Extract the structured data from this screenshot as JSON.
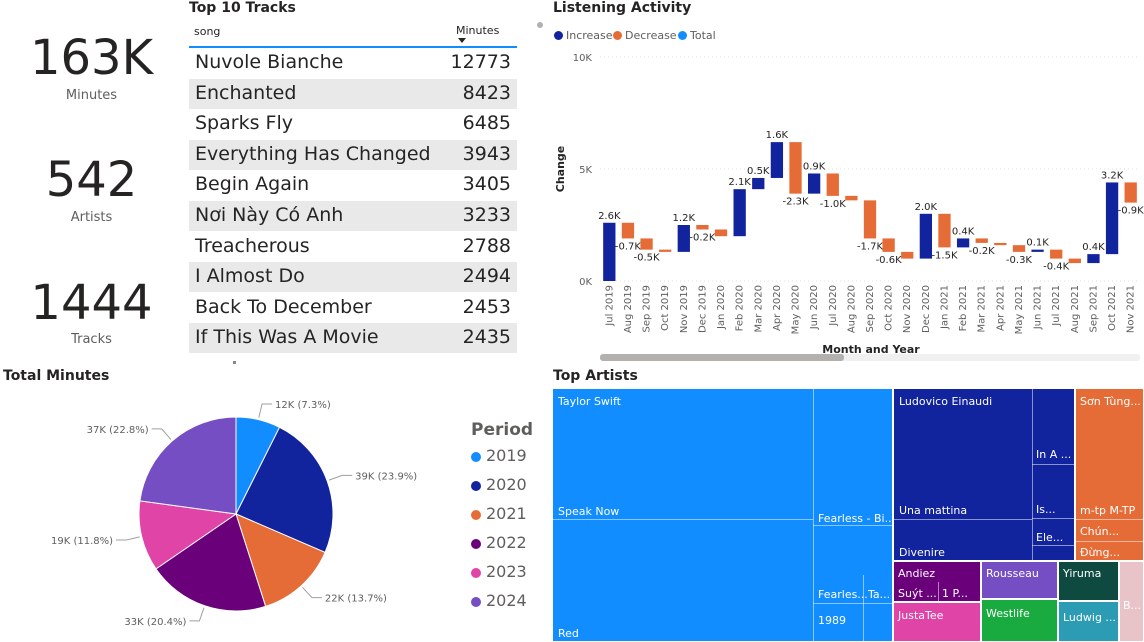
{
  "kpis": [
    {
      "value": "163K",
      "label": "Minutes"
    },
    {
      "value": "542",
      "label": "Artists"
    },
    {
      "value": "1444",
      "label": "Tracks"
    }
  ],
  "top_tracks": {
    "title": "Top 10 Tracks",
    "col_song": "song",
    "col_minutes": "Minutes",
    "rows": [
      {
        "song": "Nuvole Bianche",
        "minutes": "12773"
      },
      {
        "song": "Enchanted",
        "minutes": "8423"
      },
      {
        "song": "Sparks Fly",
        "minutes": "6485"
      },
      {
        "song": "Everything Has Changed",
        "minutes": "3943"
      },
      {
        "song": "Begin Again",
        "minutes": "3405"
      },
      {
        "song": "Nơi Này Có Anh",
        "minutes": "3233"
      },
      {
        "song": "Treacherous",
        "minutes": "2788"
      },
      {
        "song": "I Almost Do",
        "minutes": "2494"
      },
      {
        "song": "Back To December",
        "minutes": "2453"
      },
      {
        "song": "If This Was A Movie",
        "minutes": "2435"
      }
    ]
  },
  "colors": {
    "increase": "#12239e",
    "decrease": "#e66c37",
    "total": "#118dff",
    "p2019": "#118dff",
    "p2020": "#12239e",
    "p2021": "#e66c37",
    "p2022": "#6b007b",
    "p2023": "#e044a7",
    "p2024": "#744ec2"
  },
  "chart_data": [
    {
      "type": "waterfall",
      "title": "Listening Activity",
      "xlabel": "Month and Year",
      "ylabel": "Change",
      "legend": [
        "Increase",
        "Decrease",
        "Total"
      ],
      "legend_position": "top-left",
      "yticks": [
        "0K",
        "5K",
        "10K"
      ],
      "ylim": [
        0,
        10000
      ],
      "categories": [
        "Jul 2019",
        "Aug 2019",
        "Sep 2019",
        "Oct 2019",
        "Nov 2019",
        "Dec 2019",
        "Jan 2020",
        "Feb 2020",
        "Mar 2020",
        "Apr 2020",
        "May 2020",
        "Jun 2020",
        "Jul 2020",
        "Aug 2020",
        "Sep 2020",
        "Oct 2020",
        "Nov 2020",
        "Dec 2020",
        "Jan 2021",
        "Feb 2021",
        "Mar 2021",
        "Apr 2021",
        "May 2021",
        "Jun 2021",
        "Jul 2021",
        "Aug 2021",
        "Sep 2021",
        "Oct 2021",
        "Nov 2021"
      ],
      "values": [
        2600,
        -700,
        -500,
        -100,
        1200,
        -200,
        -300,
        2100,
        500,
        1600,
        -2300,
        900,
        -1000,
        -200,
        -1700,
        -600,
        -300,
        2000,
        -1500,
        400,
        -200,
        -100,
        -300,
        100,
        -400,
        -200,
        400,
        3200,
        -900
      ],
      "data_labels": [
        "2.6K",
        "-0.7K",
        "-0.5K",
        "",
        "1.2K",
        "-0.2K",
        "",
        "2.1K",
        "0.5K",
        "1.6K",
        "-2.3K",
        "0.9K",
        "-1.0K",
        "",
        "-1.7K",
        "-0.6K",
        "",
        "2.0K",
        "-1.5K",
        "0.4K",
        "-0.2K",
        "",
        "-0.3K",
        "0.1K",
        "-0.4K",
        "",
        "0.4K",
        "3.2K",
        "-0.9K"
      ],
      "grid": true
    },
    {
      "type": "pie",
      "title": "Total Minutes",
      "legend_title": "Period",
      "legend_position": "right",
      "slices": [
        {
          "name": "2019",
          "value": 12,
          "label": "12K (7.3%)"
        },
        {
          "name": "2020",
          "value": 39,
          "label": "39K (23.9%)"
        },
        {
          "name": "2021",
          "value": 22,
          "label": "22K (13.7%)"
        },
        {
          "name": "2022",
          "value": 33,
          "label": "33K (20.4%)"
        },
        {
          "name": "2023",
          "value": 19,
          "label": "19K (11.8%)"
        },
        {
          "name": "2024",
          "value": 37,
          "label": "37K (22.8%)"
        }
      ]
    }
  ],
  "treemap": {
    "title": "Top Artists",
    "labels": {
      "taylor": "Taylor Swift",
      "speak_now": "Speak Now",
      "red": "Red",
      "fearless_bi": "Fearless - Bi...",
      "fearless2": "Fearles...",
      "ta": "Ta...",
      "y1989": "1989",
      "ludovico": "Ludovico Einaudi",
      "una_mattina": "Una mattina",
      "divenire": "Divenire",
      "in_a": "In A ...",
      "is": "Is...",
      "ele": "Ele...",
      "son_tung": "Sơn Tùng...",
      "mtp": "m-tp M-TP",
      "chun": "Chún...",
      "dung": "Đừng...",
      "andiez": "Andiez",
      "suyt": "Suýt ...",
      "one_p": "1 P...",
      "rousseau": "Rousseau",
      "yiruma": "Yiruma",
      "justatee": "JustaTee",
      "westlife": "Westlife",
      "ludwig": "Ludwig ...",
      "b": "B..."
    }
  }
}
